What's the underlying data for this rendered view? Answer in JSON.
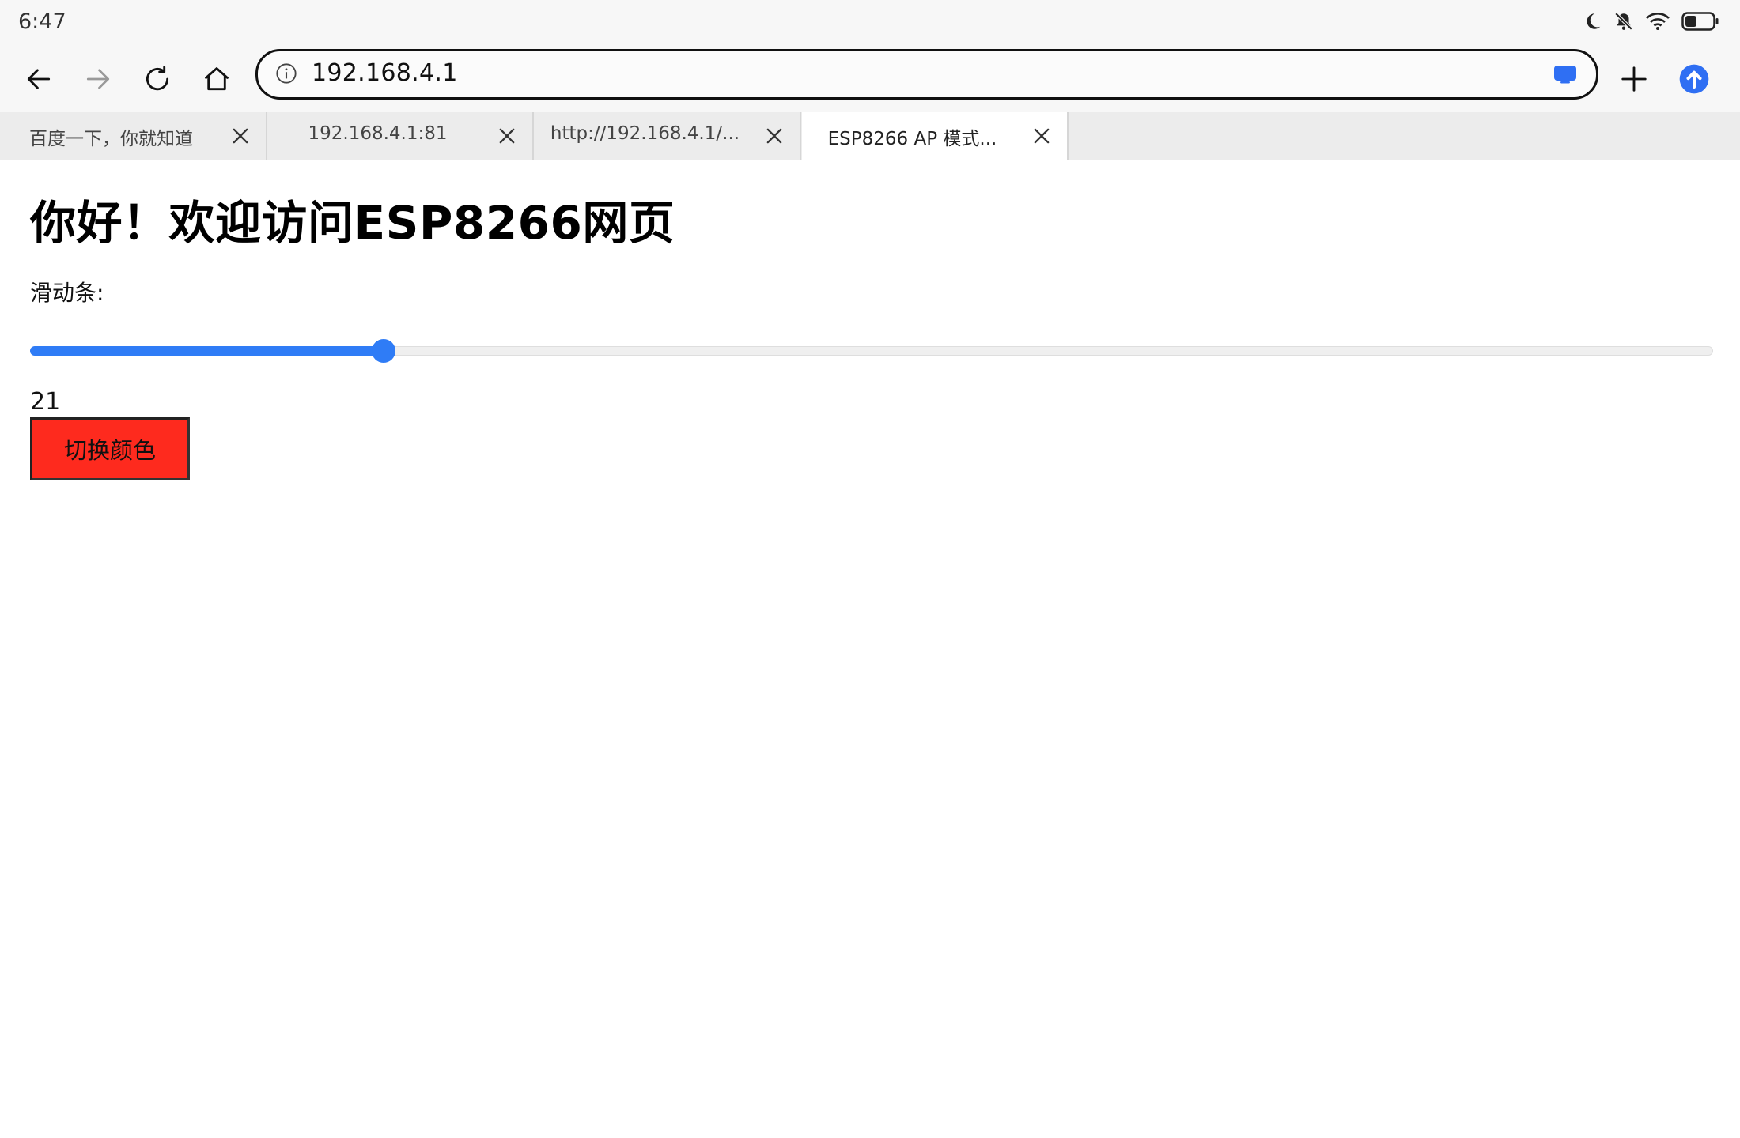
{
  "status_bar": {
    "time": "6:47",
    "icons": [
      "moon-icon",
      "bell-off-icon",
      "wifi-icon",
      "battery-icon"
    ]
  },
  "toolbar": {
    "back_icon": "arrow-left-icon",
    "forward_icon": "arrow-right-icon",
    "reload_icon": "reload-icon",
    "home_icon": "home-icon",
    "url": "192.168.4.1",
    "new_tab_icon": "plus-icon",
    "update_icon": "arrow-up-circle-icon",
    "accent": "#2f6ff3"
  },
  "tabs": [
    {
      "label": "百度一下，你就知道",
      "active": false
    },
    {
      "label": "192.168.4.1:81",
      "active": false
    },
    {
      "label": "http://192.168.4.1/...",
      "active": false
    },
    {
      "label": "ESP8266 AP 模式...",
      "active": true
    }
  ],
  "page": {
    "title": "你好！欢迎访问ESP8266网页",
    "slider_label": "滑动条:",
    "slider_value": "21",
    "slider_fraction": 0.21,
    "slider_color": "#2f7cf6",
    "button_label": "切换颜色",
    "button_color": "#fe2a1e"
  }
}
